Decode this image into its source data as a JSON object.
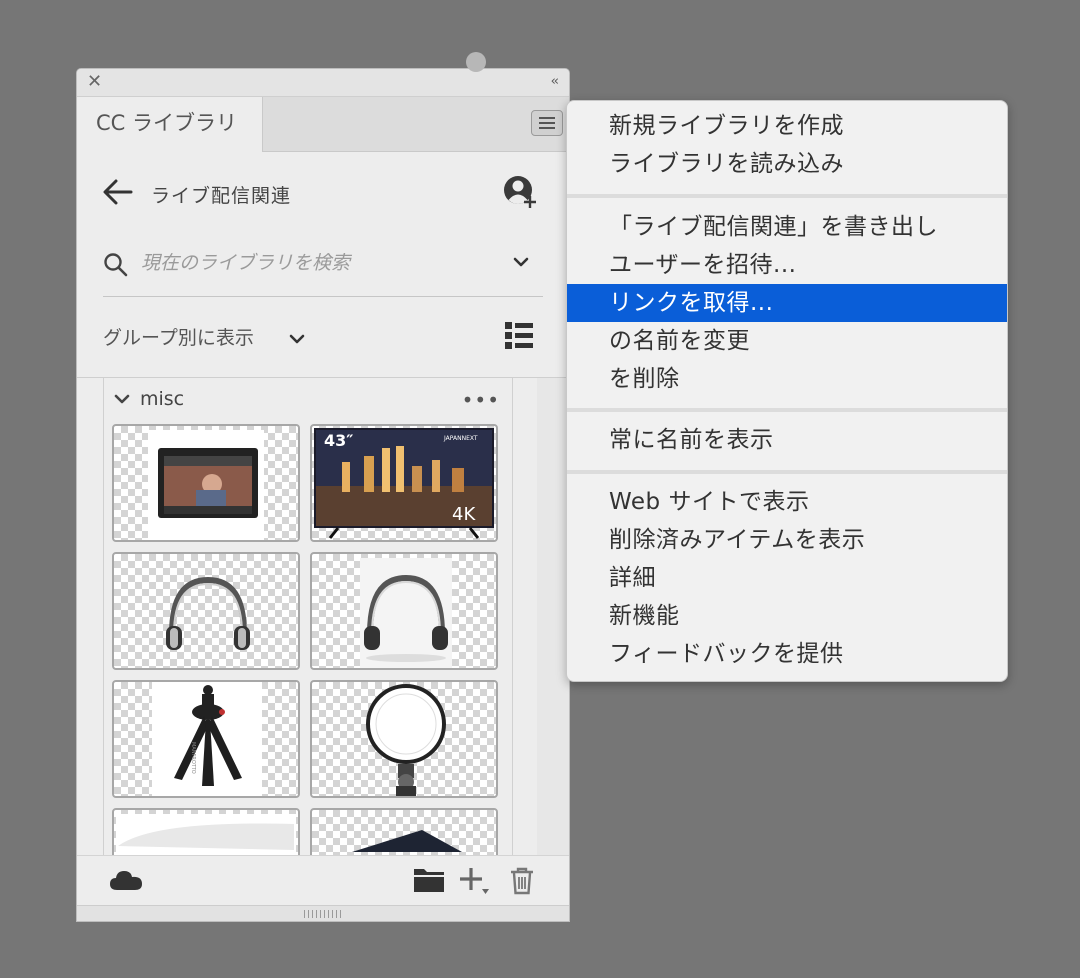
{
  "panel": {
    "close_glyph": "✕",
    "collapse_glyph": "‹‹",
    "tab_label": "CC ライブラリ",
    "library_name": "ライブ配信関連",
    "search_placeholder": "現在のライブラリを検索",
    "group_by_label": "グループ別に表示",
    "group_name": "misc",
    "more_glyph": "•••",
    "tiles": [
      {
        "name": "video-monitor"
      },
      {
        "name": "4k-tv",
        "badge_left": "43″",
        "badge_brand": "JAPANNEXT",
        "badge_right": "4K"
      },
      {
        "name": "headphones-1"
      },
      {
        "name": "headphones-2"
      },
      {
        "name": "mini-tripod",
        "brand_text": "MANFROTTO"
      },
      {
        "name": "ring-light"
      },
      {
        "name": "partial-item-1"
      },
      {
        "name": "partial-item-2"
      }
    ]
  },
  "menu": {
    "items": [
      {
        "label": "新規ライブラリを作成",
        "group": 1
      },
      {
        "label": "ライブラリを読み込み",
        "group": 1
      },
      {
        "label": "「ライブ配信関連」を書き出し",
        "group": 2
      },
      {
        "label": "ユーザーを招待...",
        "group": 2
      },
      {
        "label": "リンクを取得...",
        "group": 2,
        "highlighted": true
      },
      {
        "label": "の名前を変更",
        "group": 2
      },
      {
        "label": "を削除",
        "group": 2
      },
      {
        "label": "常に名前を表示",
        "group": 3
      },
      {
        "label": "Web サイトで表示",
        "group": 4
      },
      {
        "label": "削除済みアイテムを表示",
        "group": 4
      },
      {
        "label": "詳細",
        "group": 4
      },
      {
        "label": "新機能",
        "group": 4
      },
      {
        "label": "フィードバックを提供",
        "group": 4
      }
    ]
  },
  "colors": {
    "background": "#767676",
    "panel": "#ededed",
    "highlight": "#0a5ed8",
    "icon": "#444444"
  },
  "icons": [
    "close-icon",
    "collapse-icon",
    "hamburger-menu-icon",
    "back-arrow-icon",
    "add-user-icon",
    "search-icon",
    "chevron-down-icon",
    "list-view-icon",
    "more-icon",
    "cloud-icon",
    "folder-icon",
    "add-icon",
    "trash-icon"
  ]
}
